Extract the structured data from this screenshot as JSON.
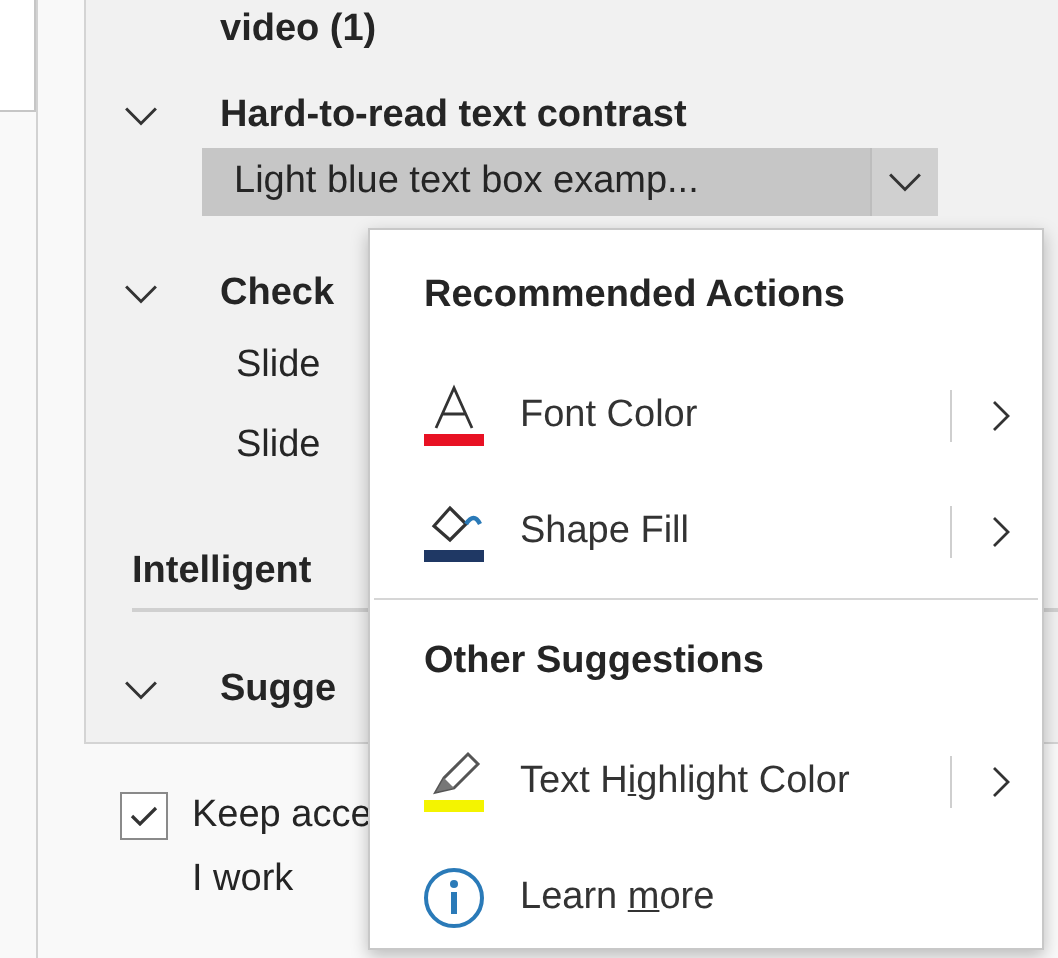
{
  "tree": [
    {
      "kind": "heading",
      "label": "video (1)"
    },
    {
      "kind": "group",
      "label": "Hard-to-read text contrast",
      "expanded": true,
      "children": [
        {
          "label": "Light blue text box examp...",
          "selected": true
        }
      ]
    },
    {
      "kind": "group",
      "label": "Check",
      "expanded": true,
      "children": [
        {
          "label": "Slide",
          "selected": false
        },
        {
          "label": "Slide",
          "selected": false
        }
      ]
    },
    {
      "kind": "section",
      "label": "Intelligent"
    },
    {
      "kind": "group",
      "label": "Sugge",
      "expanded": true
    }
  ],
  "keep_checking": {
    "lines": [
      "Keep acce",
      "I work"
    ],
    "checked": true
  },
  "context_menu": {
    "sections": [
      {
        "title": "Recommended Actions",
        "items": [
          {
            "kind": "font-color",
            "color": "#e81123",
            "label_parts": [
              "Font Color"
            ],
            "submenu": true
          },
          {
            "kind": "shape-fill",
            "color": "#1f3864",
            "label_parts": [
              "Shape Fill"
            ],
            "submenu": true
          }
        ]
      },
      {
        "title": "Other Suggestions",
        "items": [
          {
            "kind": "highlight",
            "color": "#f4f400",
            "label_parts": [
              "Text H",
              "i",
              "ghlight Color"
            ],
            "submenu": true
          },
          {
            "kind": "info",
            "label_parts": [
              "Learn ",
              "m",
              "ore"
            ],
            "submenu": false
          }
        ]
      }
    ]
  }
}
